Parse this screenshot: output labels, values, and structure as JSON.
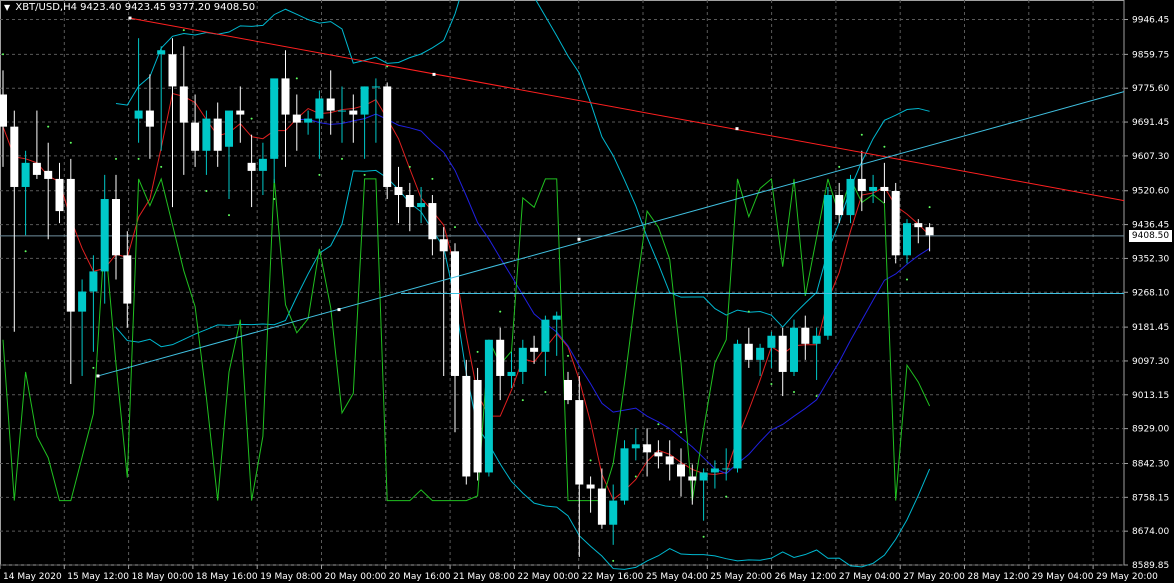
{
  "symbol": {
    "name": "XBT/USD,H4",
    "open": "9423.40",
    "high": "9423.45",
    "low": "9377.20",
    "close": "9408.50",
    "arrow_icon": "triangle-down-icon"
  },
  "current_price": "9408.50",
  "colors": {
    "background": "#000000",
    "grid": "#5a5a5a",
    "bull": "#00c8c8",
    "bear": "#ffffff",
    "trendline": "#ff2020",
    "channel": "#40c0e0",
    "fast_ma": "#e02020",
    "slow_ma": "#2020e0",
    "oscillator": "#20c020",
    "envelope": "#00b8d0",
    "sar": "#60ff60"
  },
  "chart_data": {
    "type": "candlestick",
    "title": "XBT/USD,H4",
    "ylim": [
      8589.85,
      9990
    ],
    "yticks": [
      "9946.45",
      "9859.75",
      "9775.60",
      "9691.45",
      "9607.30",
      "9520.60",
      "9436.45",
      "9352.30",
      "9268.10",
      "9181.45",
      "9097.30",
      "9013.15",
      "8929.00",
      "8842.30",
      "8758.15",
      "8674.00",
      "8589.85"
    ],
    "xticks": [
      "14 May 2020",
      "15 May 12:00",
      "18 May 00:00",
      "18 May 16:00",
      "19 May 08:00",
      "20 May 00:00",
      "20 May 16:00",
      "21 May 08:00",
      "22 May 00:00",
      "22 May 16:00",
      "25 May 04:00",
      "25 May 20:00",
      "26 May 12:00",
      "27 May 04:00",
      "27 May 20:00",
      "28 May 12:00",
      "29 May 04:00",
      "29 May 20:00"
    ],
    "candles": [
      [
        9760,
        9820,
        9580,
        9680
      ],
      [
        9680,
        9720,
        9170,
        9530
      ],
      [
        9530,
        9620,
        9410,
        9590
      ],
      [
        9590,
        9720,
        9550,
        9560
      ],
      [
        9570,
        9640,
        9400,
        9550
      ],
      [
        9550,
        9590,
        9440,
        9470
      ],
      [
        9550,
        9600,
        9040,
        9220
      ],
      [
        9220,
        9300,
        9060,
        9270
      ],
      [
        9270,
        9360,
        9120,
        9320
      ],
      [
        9320,
        9560,
        9240,
        9500
      ],
      [
        9500,
        9560,
        9300,
        9360
      ],
      [
        9360,
        9420,
        9180,
        9240
      ],
      [
        9700,
        9900,
        9640,
        9720
      ],
      [
        9720,
        9810,
        9600,
        9680
      ],
      [
        9860,
        9880,
        9620,
        9870
      ],
      [
        9860,
        9900,
        9480,
        9780
      ],
      [
        9780,
        9880,
        9560,
        9690
      ],
      [
        9690,
        9760,
        9580,
        9620
      ],
      [
        9620,
        9720,
        9560,
        9700
      ],
      [
        9700,
        9740,
        9580,
        9620
      ],
      [
        9630,
        9650,
        9500,
        9720
      ],
      [
        9720,
        9780,
        9640,
        9710
      ],
      [
        9590,
        9660,
        9480,
        9570
      ],
      [
        9570,
        9640,
        9510,
        9600
      ],
      [
        9600,
        9720,
        9540,
        9800
      ],
      [
        9800,
        9870,
        9580,
        9710
      ],
      [
        9710,
        9760,
        9620,
        9690
      ],
      [
        9690,
        9720,
        9660,
        9700
      ],
      [
        9700,
        9770,
        9600,
        9750
      ],
      [
        9750,
        9820,
        9660,
        9720
      ],
      [
        9720,
        9780,
        9640,
        9720
      ],
      [
        9720,
        9760,
        9640,
        9710
      ],
      [
        9710,
        9780,
        9600,
        9780
      ],
      [
        9780,
        9800,
        9640,
        9780
      ],
      [
        9780,
        9790,
        9500,
        9530
      ],
      [
        9530,
        9580,
        9440,
        9510
      ],
      [
        9510,
        9540,
        9420,
        9480
      ],
      [
        9480,
        9530,
        9440,
        9490
      ],
      [
        9490,
        9510,
        9360,
        9400
      ],
      [
        9400,
        9430,
        9060,
        9370
      ],
      [
        9370,
        9390,
        8920,
        9060
      ],
      [
        9060,
        9100,
        8790,
        8810
      ],
      [
        9050,
        9080,
        8800,
        8820
      ],
      [
        8820,
        9150,
        8810,
        9150
      ],
      [
        9150,
        9180,
        9000,
        9060
      ],
      [
        9060,
        9120,
        9030,
        9070
      ],
      [
        9070,
        9150,
        9040,
        9130
      ],
      [
        9130,
        9160,
        9090,
        9120
      ],
      [
        9120,
        9210,
        9060,
        9200
      ],
      [
        9200,
        9220,
        9110,
        9210
      ],
      [
        9050,
        9070,
        8990,
        9000
      ],
      [
        9000,
        9060,
        8610,
        8790
      ],
      [
        8790,
        8810,
        8720,
        8780
      ],
      [
        8780,
        8830,
        8680,
        8690
      ],
      [
        8690,
        8790,
        8640,
        8750
      ],
      [
        8750,
        8900,
        8740,
        8880
      ],
      [
        8880,
        8930,
        8850,
        8890
      ],
      [
        8890,
        8930,
        8810,
        8870
      ],
      [
        8870,
        8900,
        8830,
        8860
      ],
      [
        8860,
        8900,
        8800,
        8840
      ],
      [
        8840,
        8880,
        8760,
        8810
      ],
      [
        8810,
        8840,
        8740,
        8800
      ],
      [
        8800,
        8830,
        8700,
        8820
      ],
      [
        8820,
        8850,
        8780,
        8830
      ],
      [
        8830,
        8880,
        8800,
        8830
      ],
      [
        8830,
        9150,
        8820,
        9140
      ],
      [
        9140,
        9180,
        9080,
        9100
      ],
      [
        9100,
        9140,
        9060,
        9130
      ],
      [
        9130,
        9170,
        9080,
        9160
      ],
      [
        9160,
        9180,
        9010,
        9070
      ],
      [
        9070,
        9200,
        9060,
        9180
      ],
      [
        9180,
        9210,
        9100,
        9140
      ],
      [
        9140,
        9180,
        9050,
        9160
      ],
      [
        9160,
        9530,
        9150,
        9510
      ],
      [
        9510,
        9540,
        9440,
        9460
      ],
      [
        9460,
        9560,
        9440,
        9550
      ],
      [
        9550,
        9620,
        9470,
        9520
      ],
      [
        9520,
        9560,
        9490,
        9530
      ],
      [
        9530,
        9590,
        9490,
        9520
      ],
      [
        9520,
        9540,
        9340,
        9360
      ],
      [
        9360,
        9450,
        9340,
        9440
      ],
      [
        9440,
        9450,
        9390,
        9430
      ],
      [
        9430,
        9440,
        9370,
        9410
      ]
    ],
    "drawings": {
      "red_trendline": [
        [
          130,
          9950
        ],
        [
          1124,
          9496
        ]
      ],
      "cyan_trendline": [
        [
          98,
          9060
        ],
        [
          1124,
          9767
        ]
      ],
      "horizontal_level": 9265
    }
  }
}
